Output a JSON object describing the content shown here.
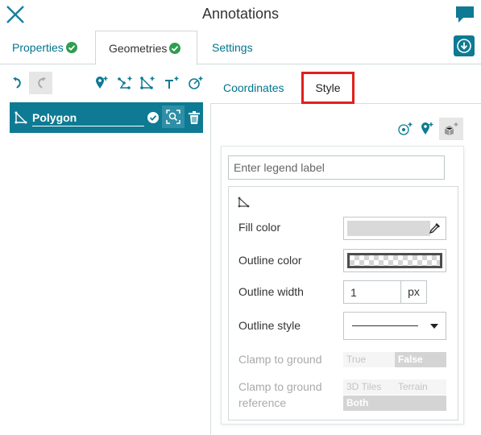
{
  "header": {
    "title": "Annotations",
    "close_icon": "close-icon",
    "chat_icon": "chat-bubble-icon",
    "accent_color": "#0e7a93"
  },
  "main_tabs": [
    {
      "label": "Properties",
      "status_icon": "check-circle-icon",
      "active": false
    },
    {
      "label": "Geometries",
      "status_icon": "check-circle-icon",
      "active": true
    },
    {
      "label": "Settings",
      "active": false
    }
  ],
  "download_icon": "download-icon",
  "left_toolbar": {
    "tools": [
      "undo-icon",
      "redo-icon",
      "add-point-icon",
      "add-line-icon",
      "add-polygon-icon",
      "add-text-icon",
      "add-circle-icon"
    ]
  },
  "geometry": {
    "name": "Polygon",
    "icon": "polygon-icon"
  },
  "sub_tabs": [
    {
      "label": "Coordinates",
      "active": false
    },
    {
      "label": "Style",
      "active": true
    }
  ],
  "style_toolbar": {
    "tools": [
      "add-point-marker-icon",
      "add-pin-icon",
      "add-model-icon"
    ]
  },
  "style": {
    "legend_placeholder": "Enter legend label",
    "fill_color_label": "Fill color",
    "fill_color": "#d9d9d9",
    "outline_color_label": "Outline color",
    "outline_width_label": "Outline width",
    "outline_width": "1",
    "outline_width_unit": "px",
    "outline_style_label": "Outline style",
    "clamp_label": "Clamp to ground",
    "clamp_options": [
      "True",
      "False"
    ],
    "clamp_selected": "False",
    "clamp_ref_label_1": "Clamp to ground",
    "clamp_ref_label_2": "reference",
    "clamp_ref_options": [
      "3D Tiles",
      "Terrain",
      "Both"
    ],
    "clamp_ref_selected": "Both"
  }
}
